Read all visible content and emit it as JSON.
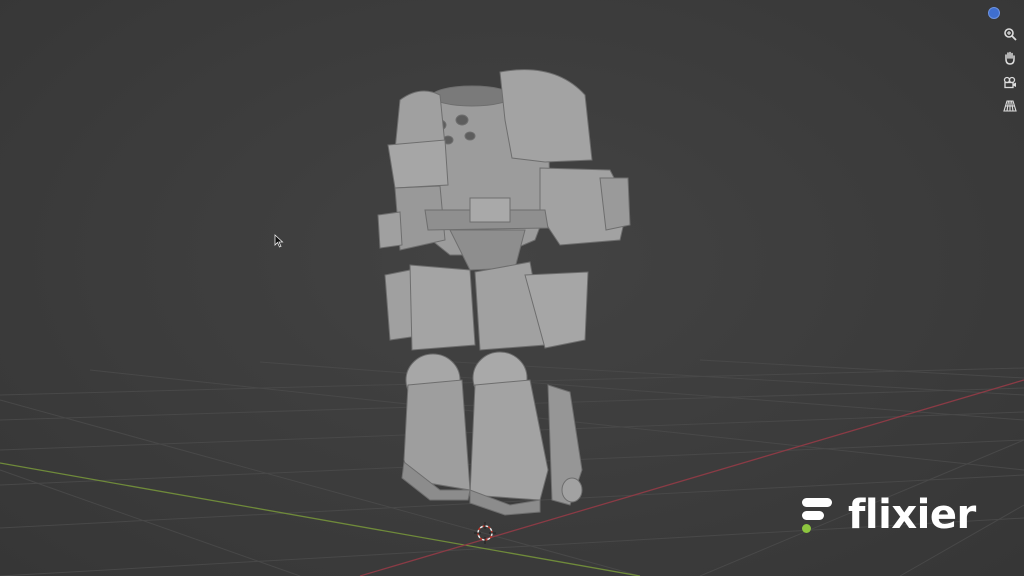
{
  "watermark": {
    "brand": "flixier"
  },
  "colors": {
    "background": "#3d3d3d",
    "grid": "#4a4a4a",
    "x_axis": "#8a3b45",
    "y_axis": "#6f8a3a",
    "model": "#9a9a9a",
    "brand_accent": "#8dc63f",
    "gizmo": "#3f6fd0"
  },
  "navigation_gizmo": {
    "buttons": [
      "zoom-icon",
      "hand-pan-icon",
      "camera-icon",
      "perspective-grid-icon"
    ]
  }
}
